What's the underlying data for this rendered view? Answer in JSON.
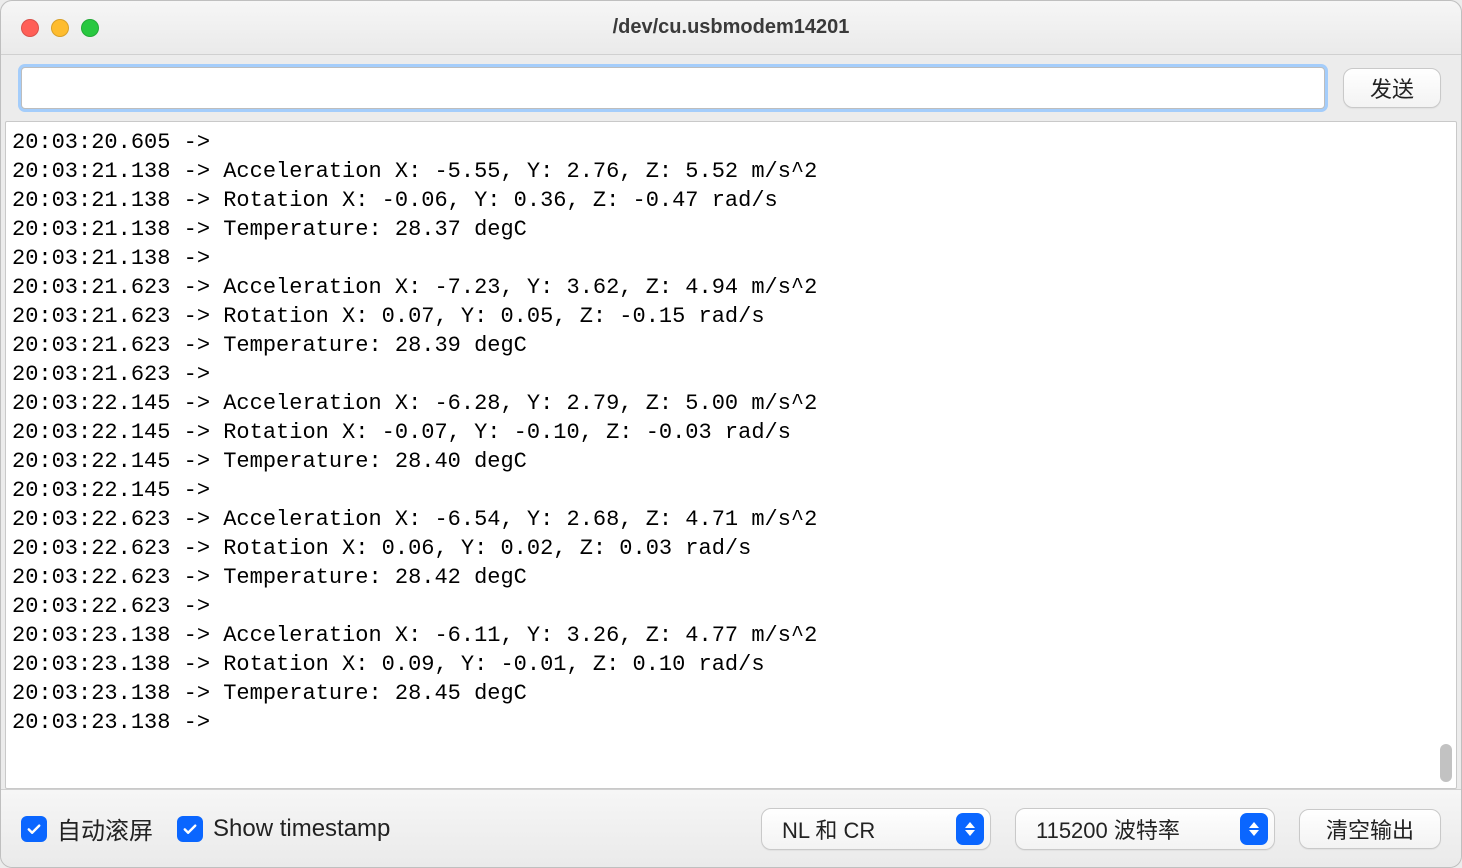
{
  "window": {
    "title": "/dev/cu.usbmodem14201"
  },
  "toolbar": {
    "send_input_value": "",
    "send_button_label": "发送"
  },
  "output_lines": [
    "20:03:20.605 -> ",
    "20:03:21.138 -> Acceleration X: -5.55, Y: 2.76, Z: 5.52 m/s^2",
    "20:03:21.138 -> Rotation X: -0.06, Y: 0.36, Z: -0.47 rad/s",
    "20:03:21.138 -> Temperature: 28.37 degC",
    "20:03:21.138 -> ",
    "20:03:21.623 -> Acceleration X: -7.23, Y: 3.62, Z: 4.94 m/s^2",
    "20:03:21.623 -> Rotation X: 0.07, Y: 0.05, Z: -0.15 rad/s",
    "20:03:21.623 -> Temperature: 28.39 degC",
    "20:03:21.623 -> ",
    "20:03:22.145 -> Acceleration X: -6.28, Y: 2.79, Z: 5.00 m/s^2",
    "20:03:22.145 -> Rotation X: -0.07, Y: -0.10, Z: -0.03 rad/s",
    "20:03:22.145 -> Temperature: 28.40 degC",
    "20:03:22.145 -> ",
    "20:03:22.623 -> Acceleration X: -6.54, Y: 2.68, Z: 4.71 m/s^2",
    "20:03:22.623 -> Rotation X: 0.06, Y: 0.02, Z: 0.03 rad/s",
    "20:03:22.623 -> Temperature: 28.42 degC",
    "20:03:22.623 -> ",
    "20:03:23.138 -> Acceleration X: -6.11, Y: 3.26, Z: 4.77 m/s^2",
    "20:03:23.138 -> Rotation X: 0.09, Y: -0.01, Z: 0.10 rad/s",
    "20:03:23.138 -> Temperature: 28.45 degC",
    "20:03:23.138 -> "
  ],
  "footer": {
    "autoscroll_label": "自动滚屏",
    "autoscroll_checked": true,
    "show_timestamp_label": "Show timestamp",
    "show_timestamp_checked": true,
    "line_ending_selected": "NL 和 CR",
    "baud_selected": "115200 波特率",
    "clear_output_label": "清空输出"
  }
}
